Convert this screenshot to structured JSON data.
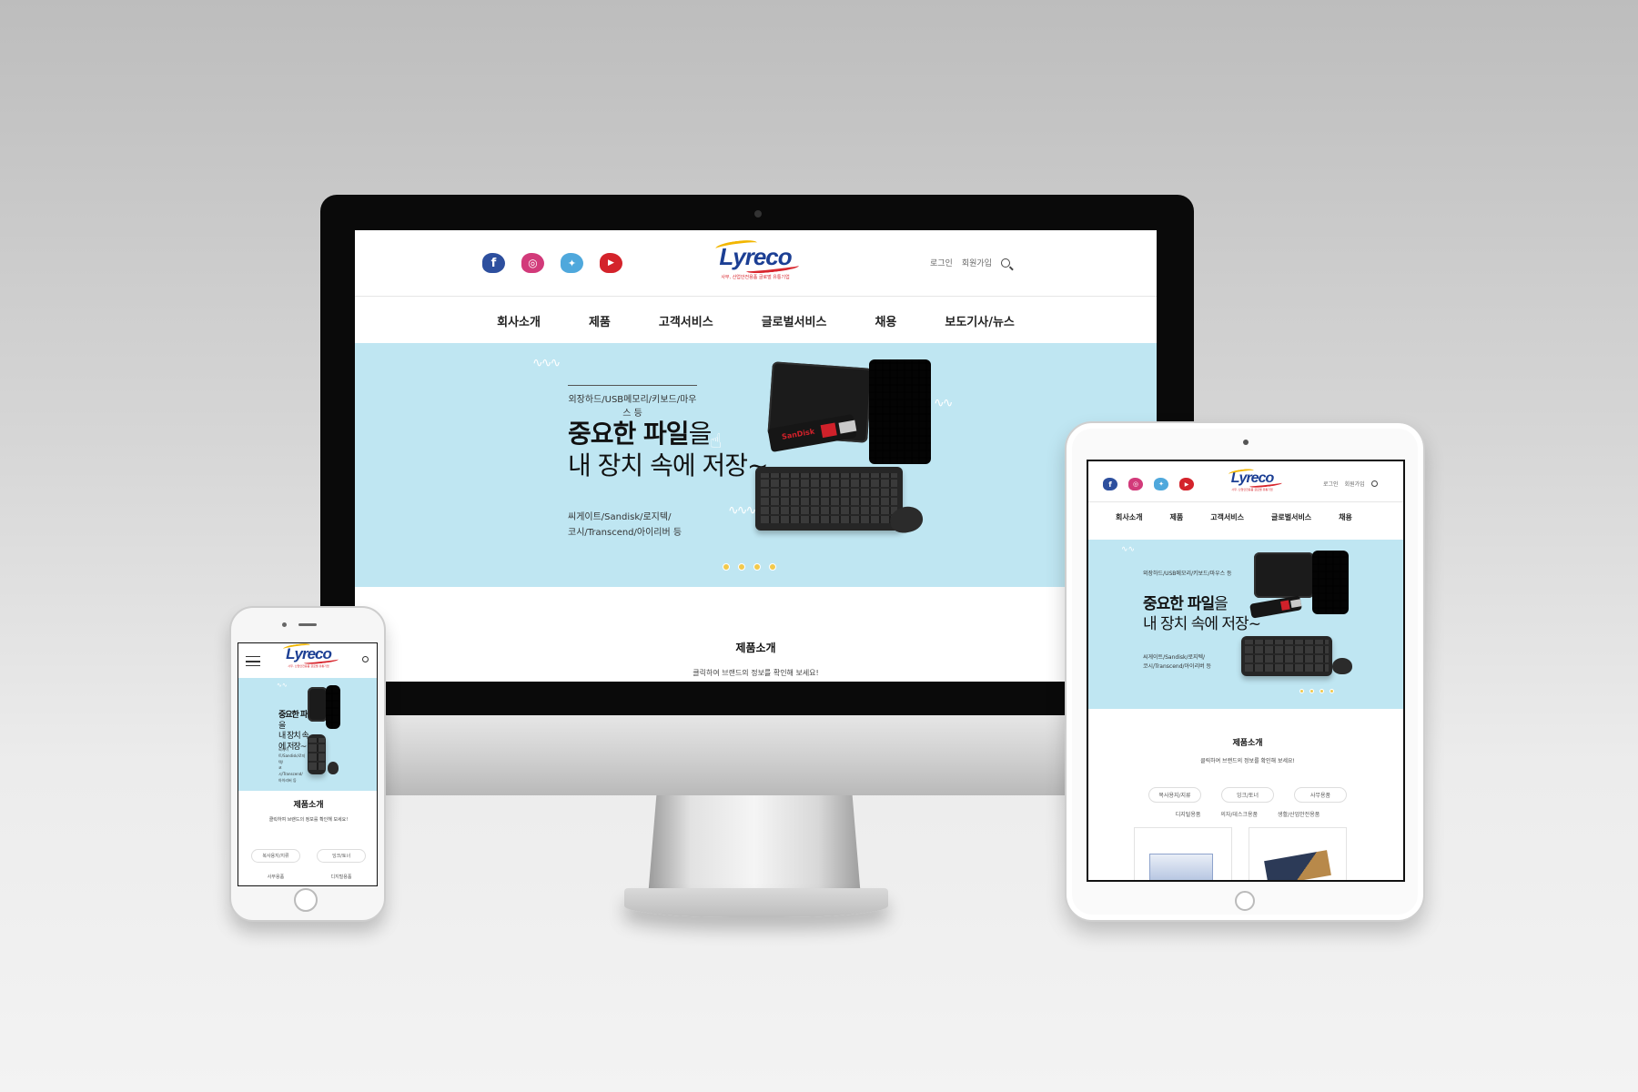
{
  "site": {
    "logo_text": "Lyreco",
    "tagline": "사무, 산업안전용품 글로벌 유통기업",
    "social": [
      {
        "name": "facebook",
        "glyph": "f",
        "color": "#2d4f9e"
      },
      {
        "name": "instagram",
        "glyph": "◎",
        "color": "#d23a7a"
      },
      {
        "name": "twitter",
        "glyph": "✦",
        "color": "#4fa8dc"
      },
      {
        "name": "youtube",
        "glyph": "▶",
        "color": "#d4232b"
      }
    ],
    "util": {
      "login": "로그인",
      "signup": "회원가입"
    },
    "nav": [
      "회사소개",
      "제품",
      "고객서비스",
      "글로벌서비스",
      "채용",
      "보도기사/뉴스"
    ],
    "banner": {
      "eyebrow": "외장하드/USB메모리/키보드/마우스 등",
      "headline_bold": "중요한 파일",
      "headline_suffix": "을",
      "headline_line2": "내 장치 속에 저장~",
      "brands_line1": "씨게이트/Sandisk/로지텍/",
      "brands_line2": "코시/Transcend/아이리버 등",
      "slide_count": 4
    },
    "section": {
      "title": "제품소개",
      "subtitle": "클릭하여 브랜드의 정보를 확인해 보세요!"
    },
    "categories": [
      "복사용지/지류",
      "잉크/토너",
      "사무용품",
      "디지털용품",
      "의자/데스크용품",
      "생활/산업안전용품"
    ],
    "usb_brand": "SanDisk"
  },
  "colors": {
    "hero_bg": "#bfe6f2",
    "logo_blue": "#1c3f94",
    "accent_yellow": "#f2b600",
    "accent_red": "#d8262d"
  }
}
